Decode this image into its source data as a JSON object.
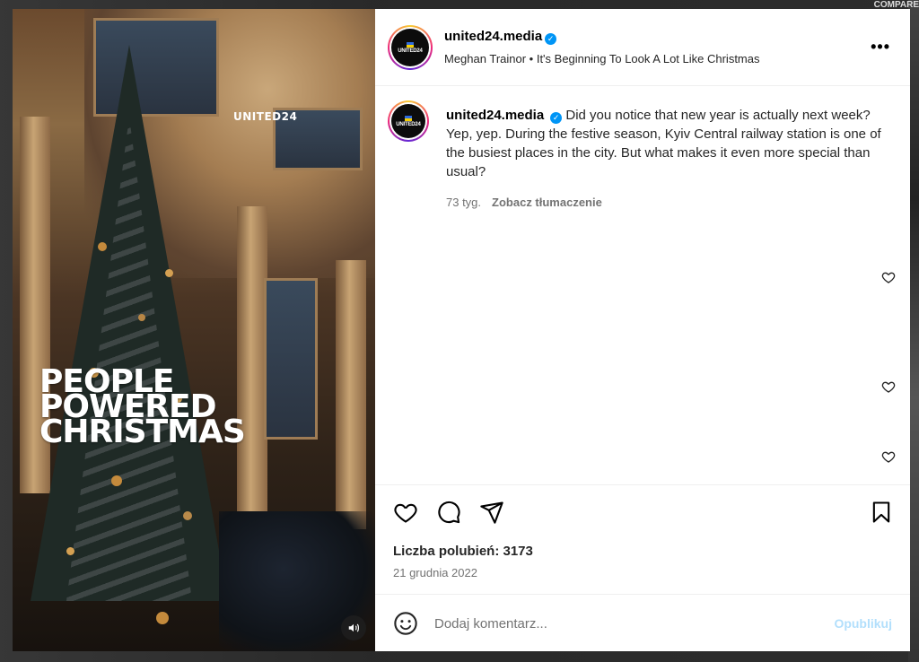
{
  "backdrop": {
    "corner_text": "COMPARE"
  },
  "media": {
    "brand_overlay": "UNITED24",
    "headline_lines": [
      "PEOPLE",
      "POWERED",
      "CHRISTMAS"
    ],
    "mute_icon": "speaker-icon"
  },
  "post_header": {
    "username": "united24.media",
    "verified": true,
    "audio": "Meghan Trainor • It's Beginning To Look A Lot Like Christmas",
    "more_label": "•••",
    "avatar_text": "UNITED24"
  },
  "caption": {
    "username": "united24.media",
    "text": "Did you notice that new year is actually next week? Yep, yep. During the festive season, Kyiv Central railway station is one of the busiest places in the city. But what makes it even more special than usual?",
    "age": "73 tyg.",
    "translate_label": "Zobacz tłumaczenie"
  },
  "actions": {
    "like_icon": "heart-icon",
    "comment_icon": "comment-icon",
    "share_icon": "paper-plane-icon",
    "save_icon": "bookmark-icon"
  },
  "likes_text": "Liczba polubień: 3173",
  "date_text": "21 grudnia 2022",
  "comment": {
    "placeholder": "Dodaj komentarz...",
    "publish_label": "Opublikuj",
    "emoji_icon": "smiley-icon"
  },
  "colors": {
    "verified_blue": "#0095f6",
    "publish_disabled": "#b2dffc",
    "secondary_text": "#737373"
  }
}
